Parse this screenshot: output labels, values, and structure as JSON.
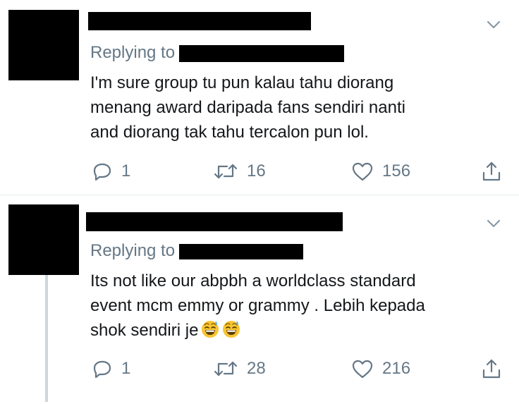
{
  "tweets": [
    {
      "replying_label": "Replying to",
      "lines": [
        "I'm sure group tu pun kalau tahu diorang",
        "menang award daripada fans sendiri nanti",
        "and diorang tak tahu tercalon pun lol."
      ],
      "emoji": [],
      "reply_count": "1",
      "retweet_count": "16",
      "like_count": "156"
    },
    {
      "replying_label": "Replying to",
      "lines": [
        "Its not like our abpbh a worldclass standard",
        "event mcm emmy or grammy . Lebih kepada",
        "shok sendiri je"
      ],
      "emoji": [
        "grinning-face-with-sweat",
        "grinning-face-with-sweat"
      ],
      "reply_count": "1",
      "retweet_count": "28",
      "like_count": "216"
    }
  ],
  "icons": {
    "reply": "reply-icon",
    "retweet": "retweet-icon",
    "like": "heart-icon",
    "share": "share-icon",
    "menu": "chevron-down-icon"
  },
  "colors": {
    "text": "#14171a",
    "secondary": "#657786",
    "divider": "#e6ecf0",
    "thread_line": "#ccd6dd",
    "redaction": "#000000"
  }
}
